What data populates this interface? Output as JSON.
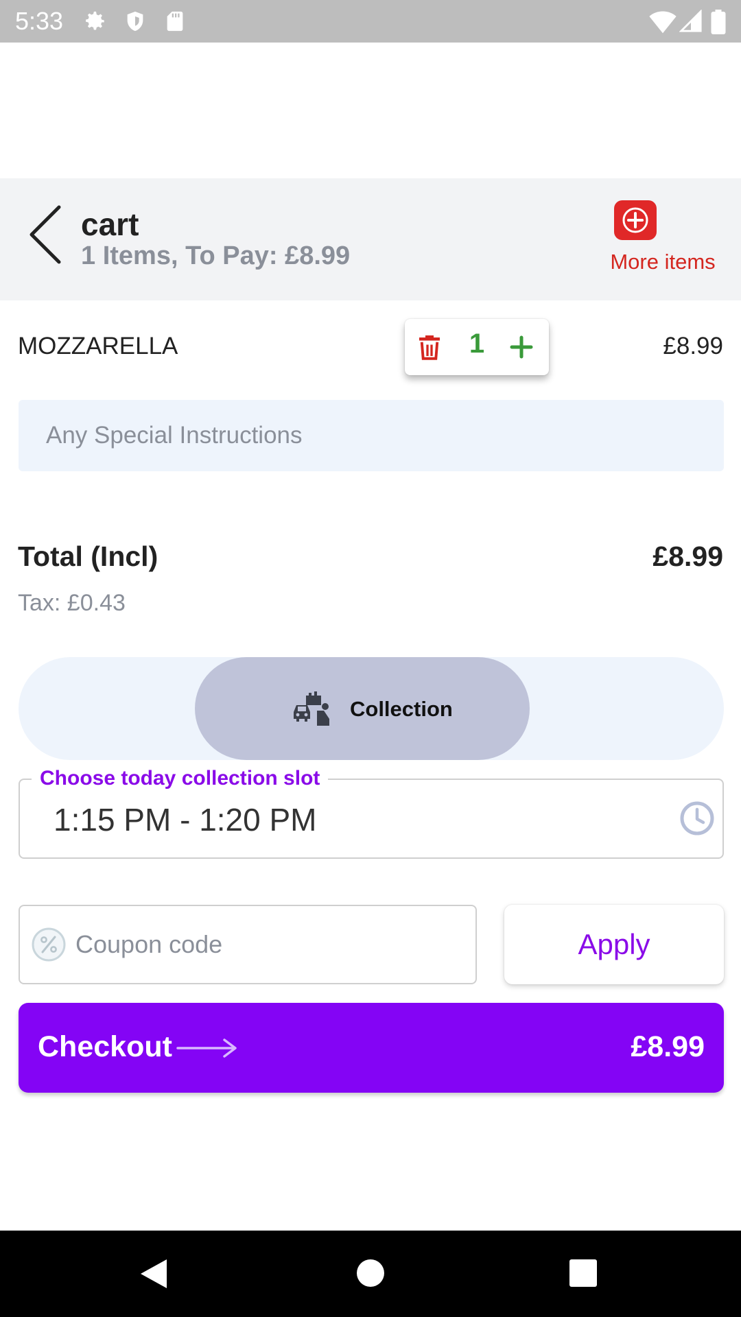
{
  "status_bar": {
    "time": "5:33",
    "icons": [
      "gear-icon",
      "shield-icon",
      "sd-card-icon",
      "wifi-icon",
      "signal-icon",
      "battery-icon"
    ]
  },
  "header": {
    "title": "cart",
    "subtitle": "1 Items, To Pay: £8.99",
    "more_items_label": "More items",
    "more_items_color": "#e02828"
  },
  "cart": {
    "items": [
      {
        "name": "MOZZARELLA",
        "quantity": "1",
        "price": "£8.99"
      }
    ],
    "instructions_placeholder": "Any Special Instructions"
  },
  "totals": {
    "total_label": "Total (Incl)",
    "total_value": "£8.99",
    "tax": "Tax: £0.43"
  },
  "order_type": {
    "selected": "Collection",
    "icon": "car-shop-icon"
  },
  "slot": {
    "label": "Choose today collection slot",
    "value": "1:15 PM - 1:20 PM",
    "icon": "clock-icon"
  },
  "coupon": {
    "placeholder": "Coupon code",
    "value": "",
    "apply_label": "Apply"
  },
  "checkout": {
    "label": "Checkout",
    "price": "£8.99",
    "color": "#8404f5"
  },
  "theme": {
    "accent": "#8a0be8",
    "danger": "#e02828",
    "success": "#3a9a3a"
  }
}
